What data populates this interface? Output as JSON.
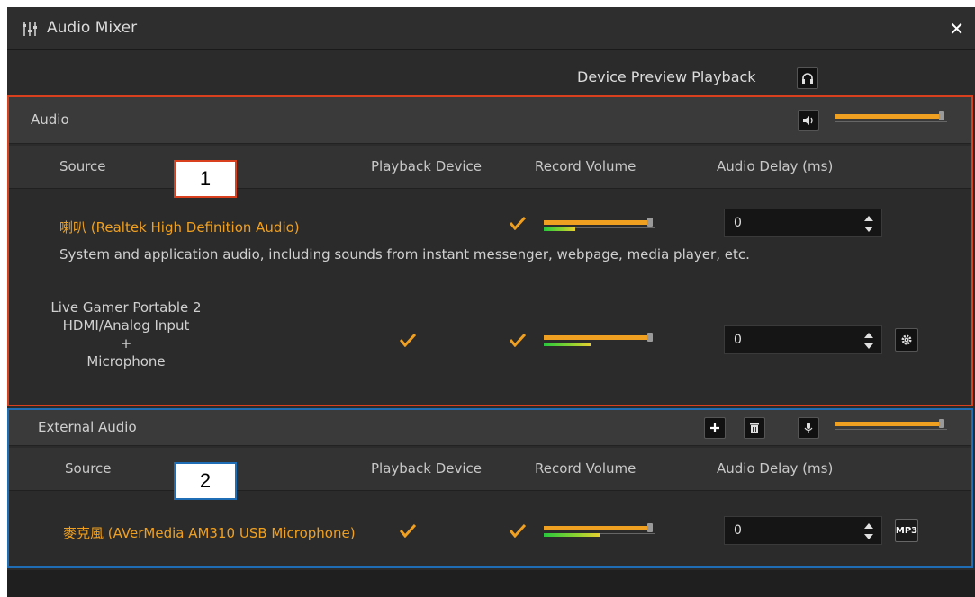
{
  "window": {
    "title": "Audio Mixer",
    "close_glyph": "✕"
  },
  "preview": {
    "label": "Device Preview Playback"
  },
  "audio_section": {
    "title": "Audio",
    "master_volume": 0.95,
    "callout": "1",
    "columns": {
      "source": "Source",
      "playback": "Playback Device",
      "record": "Record Volume",
      "delay": "Audio Delay (ms)"
    },
    "rows": [
      {
        "name": "喇叭 (Realtek High Definition Audio)",
        "description": "System and application audio, including sounds from instant messenger, webpage, media player, etc.",
        "playback_checked": false,
        "record_checked": true,
        "record_volume": 0.95,
        "level": 0.28,
        "delay": "0"
      },
      {
        "name_lines": [
          "Live Gamer Portable 2",
          "HDMI/Analog Input",
          "+",
          "Microphone"
        ],
        "playback_checked": true,
        "record_checked": true,
        "record_volume": 0.95,
        "level": 0.42,
        "delay": "0",
        "settings_icon": "gear-icon"
      }
    ]
  },
  "external_section": {
    "title": "External Audio",
    "master_volume": 0.95,
    "callout": "2",
    "columns": {
      "source": "Source",
      "playback": "Playback Device",
      "record": "Record Volume",
      "delay": "Audio Delay (ms)"
    },
    "rows": [
      {
        "name": "麥克風 (AVerMedia AM310 USB Microphone)",
        "playback_checked": true,
        "record_checked": true,
        "record_volume": 0.95,
        "level": 0.5,
        "delay": "0",
        "format_badge": "MP3"
      }
    ]
  },
  "colors": {
    "accent": "#f0a020",
    "red_outline": "#d8401e",
    "blue_outline": "#1f6db5",
    "background": "#2b2b2b"
  }
}
